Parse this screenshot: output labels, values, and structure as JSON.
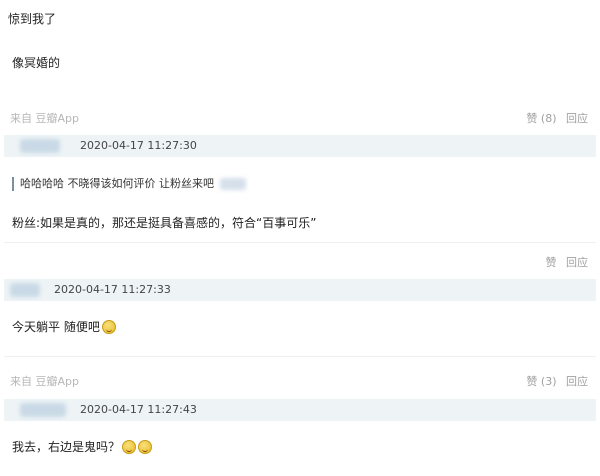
{
  "top_cut": {
    "line1": "惊到我了",
    "line2": "像冥婚的"
  },
  "comments": [
    {
      "source": "来自 豆瓣App",
      "like_label": "赞",
      "like_count": "(8)",
      "reply_label": "回应",
      "timestamp": "2020-04-17 11:27:30",
      "quote": "哈哈哈哈 不晓得该如何评价 让粉丝来吧",
      "text": "粉丝:如果是真的，那还是挺具备喜感的，符合“百事可乐”"
    },
    {
      "source": "",
      "like_label": "赞",
      "like_count": "",
      "reply_label": "回应",
      "timestamp": "2020-04-17 11:27:33",
      "text": "今天躺平 随便吧",
      "emoji": [
        "laugh-cry-emoji"
      ]
    },
    {
      "source": "来自 豆瓣App",
      "like_label": "赞",
      "like_count": "(3)",
      "reply_label": "回应",
      "timestamp": "2020-04-17 11:27:43",
      "text": "我去，右边是鬼吗？",
      "emoji": [
        "laugh-cry-emoji",
        "laugh-cry-emoji"
      ]
    }
  ],
  "colors": {
    "band": "#eef4f6",
    "meta": "#b6b6b6",
    "action": "#a0a0a0"
  }
}
